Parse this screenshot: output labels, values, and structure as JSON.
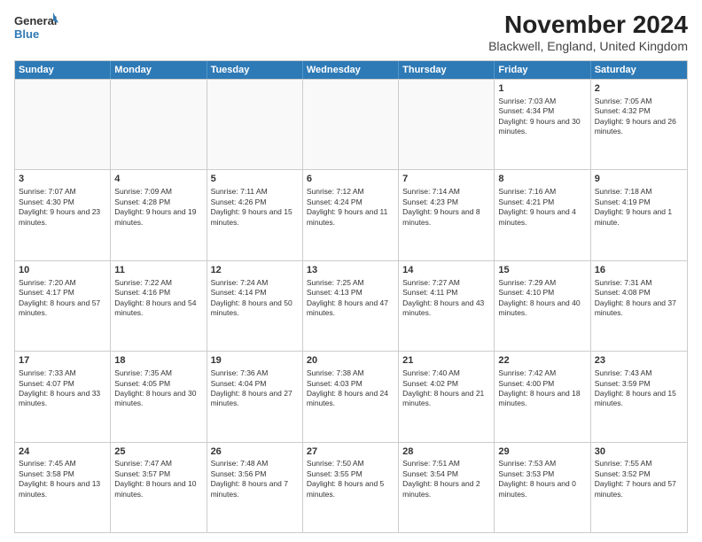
{
  "logo": {
    "line1": "General",
    "line2": "Blue"
  },
  "title": "November 2024",
  "subtitle": "Blackwell, England, United Kingdom",
  "days": [
    "Sunday",
    "Monday",
    "Tuesday",
    "Wednesday",
    "Thursday",
    "Friday",
    "Saturday"
  ],
  "rows": [
    [
      {
        "day": "",
        "info": "",
        "shaded": true
      },
      {
        "day": "",
        "info": "",
        "shaded": true
      },
      {
        "day": "",
        "info": "",
        "shaded": true
      },
      {
        "day": "",
        "info": "",
        "shaded": true
      },
      {
        "day": "",
        "info": "",
        "shaded": true
      },
      {
        "day": "1",
        "info": "Sunrise: 7:03 AM\nSunset: 4:34 PM\nDaylight: 9 hours and 30 minutes.",
        "shaded": false
      },
      {
        "day": "2",
        "info": "Sunrise: 7:05 AM\nSunset: 4:32 PM\nDaylight: 9 hours and 26 minutes.",
        "shaded": false
      }
    ],
    [
      {
        "day": "3",
        "info": "Sunrise: 7:07 AM\nSunset: 4:30 PM\nDaylight: 9 hours and 23 minutes.",
        "shaded": false
      },
      {
        "day": "4",
        "info": "Sunrise: 7:09 AM\nSunset: 4:28 PM\nDaylight: 9 hours and 19 minutes.",
        "shaded": false
      },
      {
        "day": "5",
        "info": "Sunrise: 7:11 AM\nSunset: 4:26 PM\nDaylight: 9 hours and 15 minutes.",
        "shaded": false
      },
      {
        "day": "6",
        "info": "Sunrise: 7:12 AM\nSunset: 4:24 PM\nDaylight: 9 hours and 11 minutes.",
        "shaded": false
      },
      {
        "day": "7",
        "info": "Sunrise: 7:14 AM\nSunset: 4:23 PM\nDaylight: 9 hours and 8 minutes.",
        "shaded": false
      },
      {
        "day": "8",
        "info": "Sunrise: 7:16 AM\nSunset: 4:21 PM\nDaylight: 9 hours and 4 minutes.",
        "shaded": false
      },
      {
        "day": "9",
        "info": "Sunrise: 7:18 AM\nSunset: 4:19 PM\nDaylight: 9 hours and 1 minute.",
        "shaded": false
      }
    ],
    [
      {
        "day": "10",
        "info": "Sunrise: 7:20 AM\nSunset: 4:17 PM\nDaylight: 8 hours and 57 minutes.",
        "shaded": false
      },
      {
        "day": "11",
        "info": "Sunrise: 7:22 AM\nSunset: 4:16 PM\nDaylight: 8 hours and 54 minutes.",
        "shaded": false
      },
      {
        "day": "12",
        "info": "Sunrise: 7:24 AM\nSunset: 4:14 PM\nDaylight: 8 hours and 50 minutes.",
        "shaded": false
      },
      {
        "day": "13",
        "info": "Sunrise: 7:25 AM\nSunset: 4:13 PM\nDaylight: 8 hours and 47 minutes.",
        "shaded": false
      },
      {
        "day": "14",
        "info": "Sunrise: 7:27 AM\nSunset: 4:11 PM\nDaylight: 8 hours and 43 minutes.",
        "shaded": false
      },
      {
        "day": "15",
        "info": "Sunrise: 7:29 AM\nSunset: 4:10 PM\nDaylight: 8 hours and 40 minutes.",
        "shaded": false
      },
      {
        "day": "16",
        "info": "Sunrise: 7:31 AM\nSunset: 4:08 PM\nDaylight: 8 hours and 37 minutes.",
        "shaded": false
      }
    ],
    [
      {
        "day": "17",
        "info": "Sunrise: 7:33 AM\nSunset: 4:07 PM\nDaylight: 8 hours and 33 minutes.",
        "shaded": false
      },
      {
        "day": "18",
        "info": "Sunrise: 7:35 AM\nSunset: 4:05 PM\nDaylight: 8 hours and 30 minutes.",
        "shaded": false
      },
      {
        "day": "19",
        "info": "Sunrise: 7:36 AM\nSunset: 4:04 PM\nDaylight: 8 hours and 27 minutes.",
        "shaded": false
      },
      {
        "day": "20",
        "info": "Sunrise: 7:38 AM\nSunset: 4:03 PM\nDaylight: 8 hours and 24 minutes.",
        "shaded": false
      },
      {
        "day": "21",
        "info": "Sunrise: 7:40 AM\nSunset: 4:02 PM\nDaylight: 8 hours and 21 minutes.",
        "shaded": false
      },
      {
        "day": "22",
        "info": "Sunrise: 7:42 AM\nSunset: 4:00 PM\nDaylight: 8 hours and 18 minutes.",
        "shaded": false
      },
      {
        "day": "23",
        "info": "Sunrise: 7:43 AM\nSunset: 3:59 PM\nDaylight: 8 hours and 15 minutes.",
        "shaded": false
      }
    ],
    [
      {
        "day": "24",
        "info": "Sunrise: 7:45 AM\nSunset: 3:58 PM\nDaylight: 8 hours and 13 minutes.",
        "shaded": false
      },
      {
        "day": "25",
        "info": "Sunrise: 7:47 AM\nSunset: 3:57 PM\nDaylight: 8 hours and 10 minutes.",
        "shaded": false
      },
      {
        "day": "26",
        "info": "Sunrise: 7:48 AM\nSunset: 3:56 PM\nDaylight: 8 hours and 7 minutes.",
        "shaded": false
      },
      {
        "day": "27",
        "info": "Sunrise: 7:50 AM\nSunset: 3:55 PM\nDaylight: 8 hours and 5 minutes.",
        "shaded": false
      },
      {
        "day": "28",
        "info": "Sunrise: 7:51 AM\nSunset: 3:54 PM\nDaylight: 8 hours and 2 minutes.",
        "shaded": false
      },
      {
        "day": "29",
        "info": "Sunrise: 7:53 AM\nSunset: 3:53 PM\nDaylight: 8 hours and 0 minutes.",
        "shaded": false
      },
      {
        "day": "30",
        "info": "Sunrise: 7:55 AM\nSunset: 3:52 PM\nDaylight: 7 hours and 57 minutes.",
        "shaded": false
      }
    ]
  ]
}
